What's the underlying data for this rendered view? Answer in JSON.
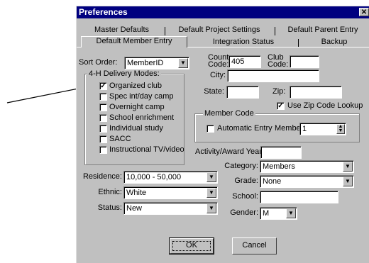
{
  "window": {
    "title": "Preferences",
    "close_glyph": "✕"
  },
  "tabs": {
    "row1": [
      "Master Defaults",
      "Default Project Settings",
      "Default Parent Entry"
    ],
    "row2": [
      "Default Member Entry",
      "Integration Status",
      "Backup"
    ]
  },
  "form": {
    "sort_order_label": "Sort Order:",
    "sort_order_value": "MemberID",
    "county_code_label": "County Code:",
    "county_code_value": "405",
    "club_code_label": "Club Code:",
    "club_code_value": "",
    "city_label": "City:",
    "city_value": "",
    "state_label": "State:",
    "state_value": "",
    "zip_label": "Zip:",
    "zip_value": "",
    "use_zip_lookup_label": "Use Zip Code Lookup",
    "use_zip_lookup_checked": true,
    "delivery_modes": {
      "label": "4-H Delivery Modes:",
      "items": [
        {
          "label": "Organized club",
          "checked": true
        },
        {
          "label": "Spec int/day camp",
          "checked": false
        },
        {
          "label": "Overnight camp",
          "checked": false
        },
        {
          "label": "School enrichment",
          "checked": false
        },
        {
          "label": "Individual study",
          "checked": false
        },
        {
          "label": "SACC",
          "checked": false
        },
        {
          "label": "Instructional TV/video",
          "checked": false
        }
      ]
    },
    "member_code": {
      "label": "Member Code",
      "automatic_entry_label": "Automatic Entry",
      "automatic_entry_checked": false,
      "member_label": "Member:",
      "member_value": "1"
    },
    "activity_year_label": "Activity/Award Year:",
    "activity_year_value": "",
    "category_label": "Category:",
    "category_value": "Members",
    "grade_label": "Grade:",
    "grade_value": "None",
    "school_label": "School:",
    "school_value": "",
    "gender_label": "Gender:",
    "gender_value": "M",
    "residence_label": "Residence:",
    "residence_value": "10,000 - 50,000",
    "ethnic_label": "Ethnic:",
    "ethnic_value": "White",
    "status_label": "Status:",
    "status_value": "New"
  },
  "buttons": {
    "ok": "OK",
    "cancel": "Cancel"
  },
  "icons": {
    "dropdown": "chevron-down-icon",
    "check": "check-icon",
    "spin": "spin-arrows-icon"
  }
}
